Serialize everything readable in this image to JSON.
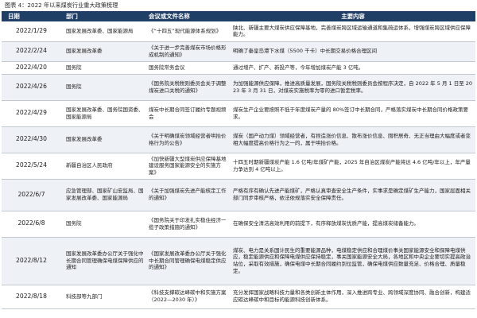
{
  "caption": "图表 4：2022 年以来煤炭行业重大政策梳理",
  "table": {
    "headers": {
      "date": "日期",
      "dept": "部门",
      "name": "会议或文件名称",
      "content": "主要内容"
    },
    "rows": [
      {
        "date": "2022/1/29",
        "dept": "国家发展改革委、国家能源局",
        "name": "《“十四五”现代能源体系规划》",
        "content": "陕北、新疆主要大煤炭供应保障基地，完善煤炭跨区域运输通道和集疏运体系，增强煤炭跨区域供应保障能力。"
      },
      {
        "date": "2022/2/24",
        "dept": "国家发展改革委",
        "name": "《关于进一步完善煤炭市场价格形成机制的通知》",
        "content": "明确了秦皇岛港下水煤（5500 千卡）中长期交易价格合理区间"
      },
      {
        "date": "2022/4/20",
        "dept": "国务院",
        "name": "国务院常务会议",
        "content": "通过增产、扩产、新投产等，今年增加煤炭产能 3 亿吨。"
      },
      {
        "date": "2022/4/26",
        "dept": "国务院",
        "name": "《国务院关税税则委员会关于调整煤炭进口关税的通知》",
        "content": "为加强能源供应保障，推进高质量发展，国务院关税税则委员会按程序决定，自 2022 年 5 月 1 日至 2023 年 3 月 31 日，对煤炭实施税率为零的进口暂定税率。"
      },
      {
        "date": "2022/4/29",
        "dept": "国家发展改革委、国务院国资委、国家能源局",
        "name": "煤炭中长期合同签订履约专题视频会",
        "content": "煤炭生产企业要按照不低于年度煤炭产量的 80%签订中长期合同，严格落实煤炭中长期合同价格政策要求。"
      },
      {
        "date": "2022/4/30",
        "dept": "国家发展改革委",
        "name": "《关于明确煤炭领域经营者哄抬价格行为的公告》",
        "content": "煤炭（国产动力煤）领域经营者，有捏造涨价信息、散布涨价信息、囤积居奇、无正当理由大幅度或者变相大幅度提高价格行为之一的，属于哄抬价格。"
      },
      {
        "date": "2022/5/24",
        "dept": "新疆自治区人民政府",
        "name": "《加快新疆大型煤炭供应保障基地建设服务国家能源安全的实施方案》",
        "content": "十四五时期新疆煤炭产能 1.6 亿吨/年煤矿产能，2025 年自治区煤炭产能将达 4.6 亿吨/年以上，年产量力争达到 4 亿吨以上。"
      },
      {
        "date": "2022/6/7",
        "dept": "应急管理部、国家矿山安监局、国家发展改革委、国家能源局",
        "name": "《关于加强煤炭先进产能核定工作的通知》",
        "content": "严格有序有确认先进产能煤矿，严格认真审查安全生产条件，实事求是确定煤矿生产能力，国家层面相关部门同步审核严格，依法依规落实安全保障责任。"
      },
      {
        "date": "2022/6/8",
        "dept": "国务院",
        "name": "《国务院关于印发扎实稳住经济一揽子政策措施的通知》",
        "content": "在确保安全清洁高效利用的前提下，有序释放煤炭优质产能，提高煤炭储备能力。"
      },
      {
        "date": "2022/8/12",
        "dept": "国家发展改革委办公厅关于强化中长期合同管理确保电煤保障供应的通知",
        "name": "《国家发展改革委办公厅关于强化中长期合同管理确保电煤稳定供应的通知》",
        "content": "煤炭、电力是关系国计民生的重要能源品种，电煤稳定供应和合理煤价事关国家能源安全和保障电煤供应，稳定能源供应和保障电煤供应保持稳定，事关国家能源安全大局，各地区和中央企业要切实提高政治站位，采取有效措施，确保电煤中长期合同履约到位监管，确保电煤供应数量充足、价格合理、质量稳定。"
      },
      {
        "date": "2022/8/18",
        "dept": "科技部等九部门",
        "name": "《科技支撑碳达峰碳中和实施方案（2022—2030 年）》",
        "content": "充分发挥国家战略科技力量和各类创新主体作用，深入推进跨专业、跨领域深度协同、融合创新，构建适应碳达峰碳中和目标的能源科技创新体系。"
      }
    ]
  }
}
